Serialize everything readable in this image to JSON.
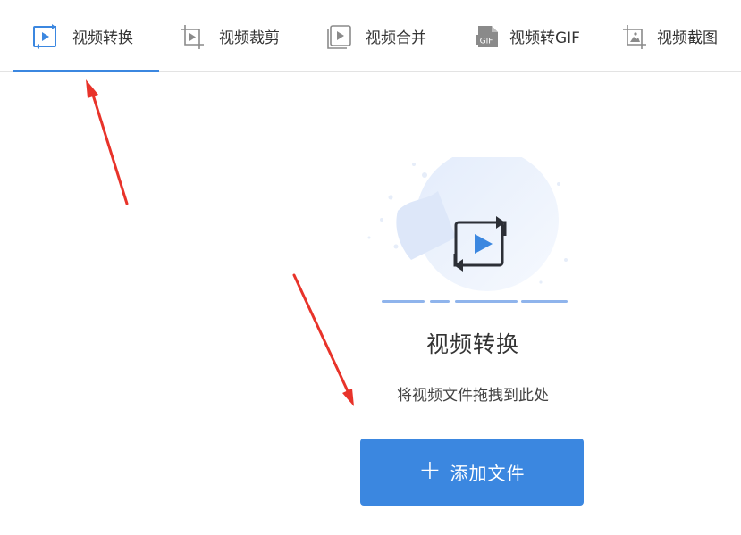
{
  "tabs": [
    {
      "label": "视频转换",
      "icon": "video-convert-icon",
      "active": true
    },
    {
      "label": "视频裁剪",
      "icon": "video-crop-icon",
      "active": false
    },
    {
      "label": "视频合并",
      "icon": "video-merge-icon",
      "active": false
    },
    {
      "label": "视频转GIF",
      "icon": "gif-icon",
      "active": false
    },
    {
      "label": "视频截图",
      "icon": "screenshot-icon",
      "active": false
    }
  ],
  "main": {
    "title": "视频转换",
    "subtitle": "将视频文件拖拽到此处",
    "add_button_plus": "+",
    "add_button_label": "添加文件"
  },
  "colors": {
    "accent": "#3b87e0",
    "annotation_arrow": "#e8332a"
  }
}
